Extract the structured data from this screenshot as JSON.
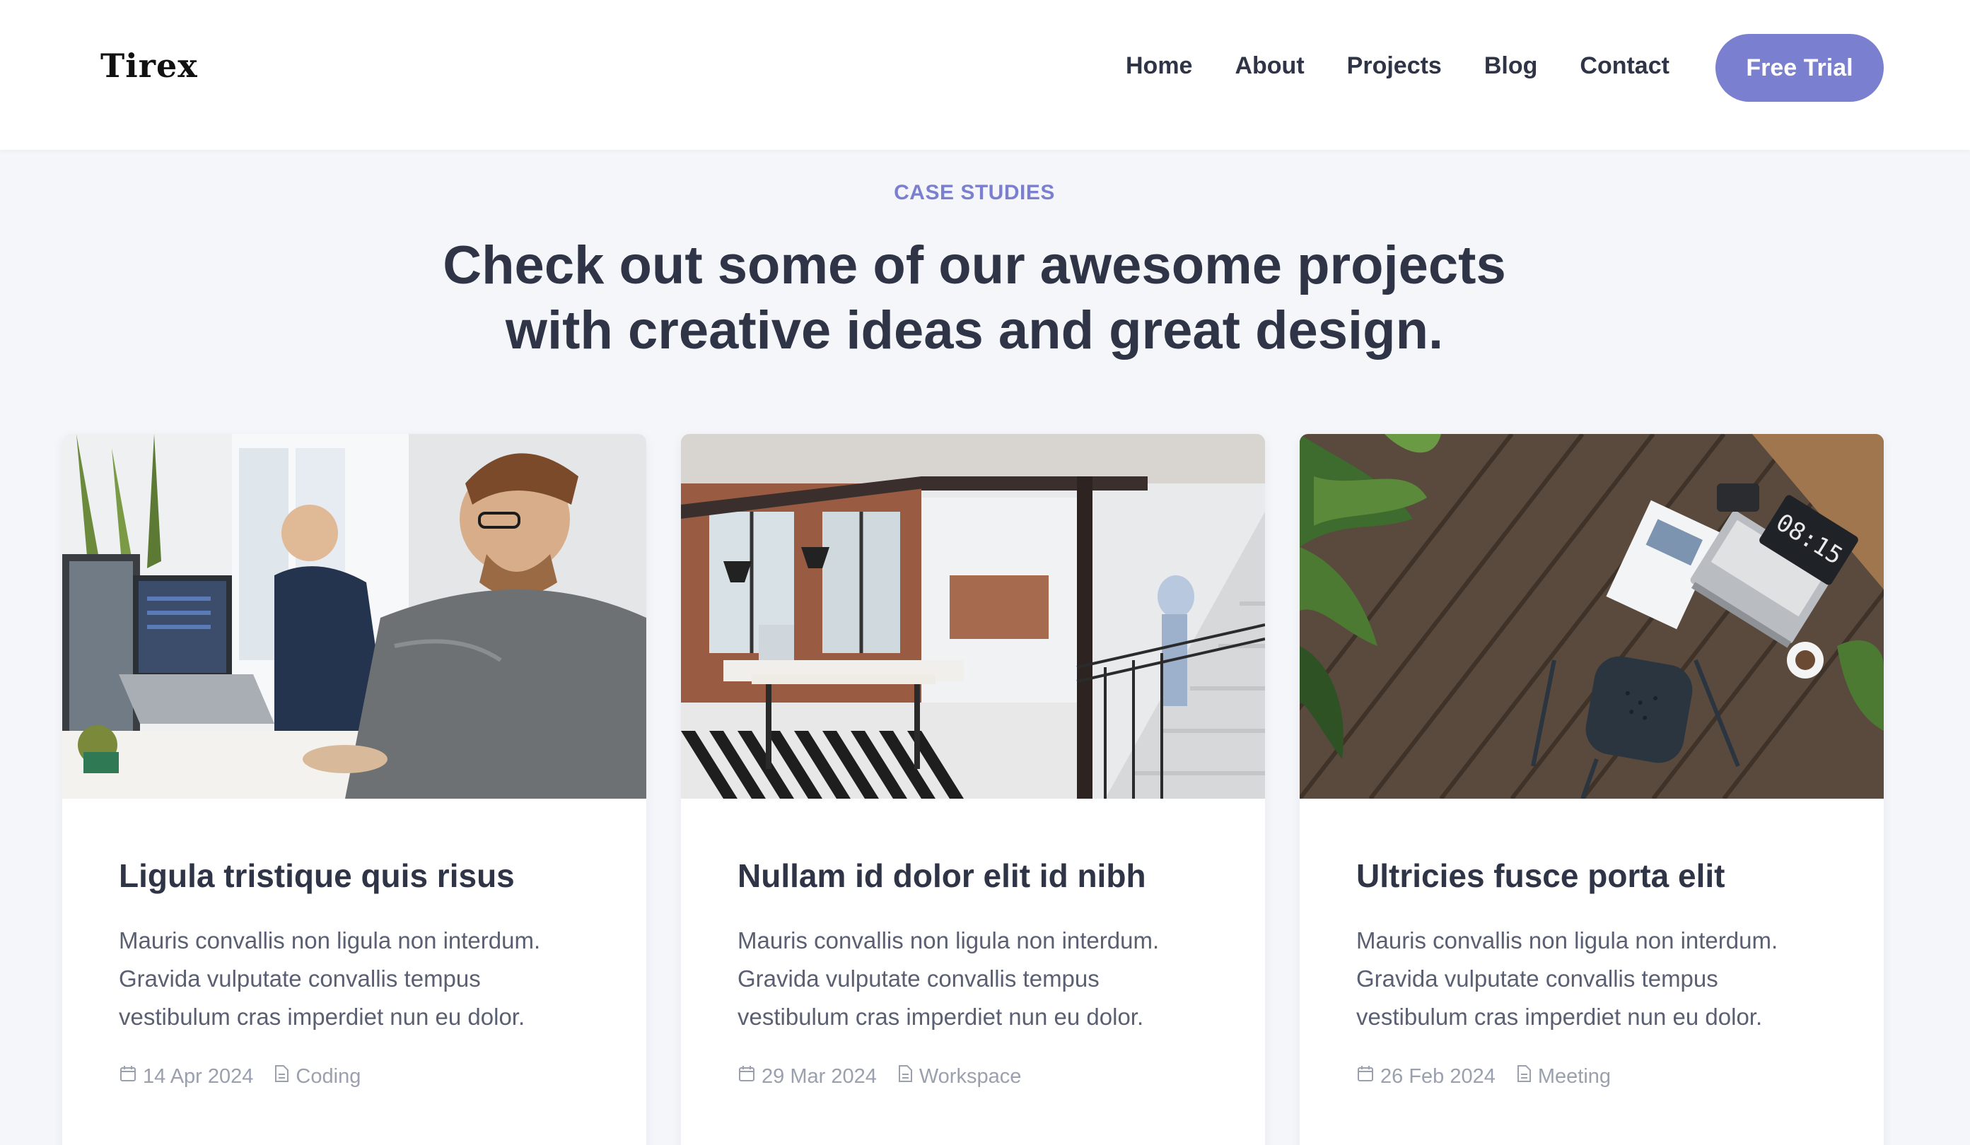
{
  "header": {
    "logo": "Tirex",
    "nav": [
      "Home",
      "About",
      "Projects",
      "Blog",
      "Contact"
    ],
    "cta": "Free Trial"
  },
  "section": {
    "eyebrow": "CASE STUDIES",
    "headline_line1": "Check out some of our awesome projects",
    "headline_line2": "with creative ideas and great design."
  },
  "cards": [
    {
      "title": "Ligula tristique quis risus",
      "desc_line1": "Mauris convallis non ligula non interdum.",
      "desc_line2": "Gravida vulputate convallis tempus",
      "desc_line3": "vestibulum cras imperdiet nun eu dolor.",
      "date": "14 Apr 2024",
      "category": "Coding"
    },
    {
      "title": "Nullam id dolor elit id nibh",
      "desc_line1": "Mauris convallis non ligula non interdum.",
      "desc_line2": "Gravida vulputate convallis tempus",
      "desc_line3": "vestibulum cras imperdiet nun eu dolor.",
      "date": "29 Mar 2024",
      "category": "Workspace"
    },
    {
      "title": "Ultricies fusce porta elit",
      "desc_line1": "Mauris convallis non ligula non interdum.",
      "desc_line2": "Gravida vulputate convallis tempus",
      "desc_line3": "vestibulum cras imperdiet nun eu dolor.",
      "date": "26 Feb 2024",
      "category": "Meeting"
    }
  ],
  "photo_clock": "08:15",
  "colors": {
    "accent": "#7b7fcf",
    "text": "#2f3547",
    "muted": "#9aa0ad",
    "background": "#f5f6fa"
  },
  "icons": [
    "calendar-icon",
    "document-icon"
  ]
}
